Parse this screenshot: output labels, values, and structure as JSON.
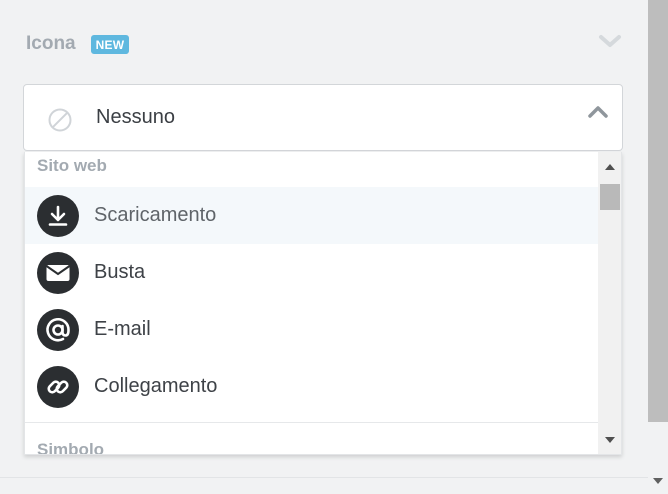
{
  "section": {
    "title": "Icona",
    "badge": "NEW"
  },
  "select": {
    "value": "Nessuno",
    "icon": "none-icon"
  },
  "dropdown": {
    "groups": [
      {
        "label": "Sito web",
        "options": [
          {
            "label": "Scaricamento",
            "icon": "download-icon",
            "active": true
          },
          {
            "label": "Busta",
            "icon": "envelope-icon",
            "active": false
          },
          {
            "label": "E-mail",
            "icon": "at-sign-icon",
            "active": false
          },
          {
            "label": "Collegamento",
            "icon": "link-icon",
            "active": false
          }
        ]
      },
      {
        "label": "Simbolo",
        "options": []
      }
    ]
  },
  "colors": {
    "badge": "#5fb8df",
    "icon_circle": "#2b2e31",
    "active_row": "#f4f8fb"
  }
}
